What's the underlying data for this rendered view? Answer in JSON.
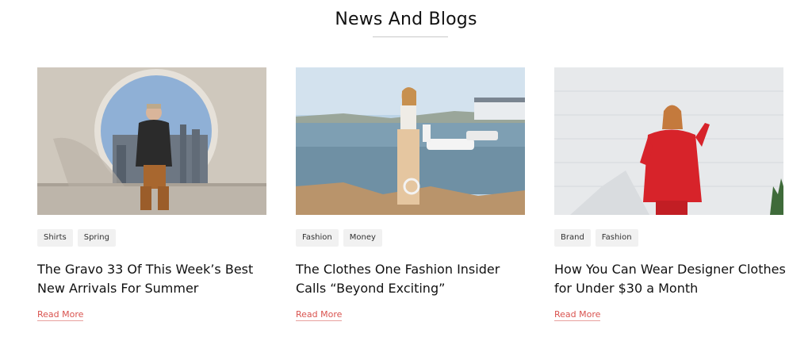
{
  "section": {
    "title": "News And Blogs"
  },
  "posts": [
    {
      "image_alt": "young man sitting in front of circular wall opening",
      "tags": [
        "Shirts",
        "Spring"
      ],
      "title": "The Gravo 33 Of This Week’s Best New Arrivals For Summer",
      "read_more": "Read More"
    },
    {
      "image_alt": "woman standing on rocks by the sea",
      "tags": [
        "Fashion",
        "Money"
      ],
      "title": "The Clothes One Fashion Insider Calls “Beyond Exciting”",
      "read_more": "Read More"
    },
    {
      "image_alt": "woman in red sweatshirt against white wall",
      "tags": [
        "Brand",
        "Fashion"
      ],
      "title": "How You Can Wear Designer Clothes for Under $30 a Month",
      "read_more": "Read More"
    }
  ],
  "colors": {
    "accent": "#d9534f",
    "tag_bg": "#f1f1f1",
    "rule": "#c9c9c9"
  }
}
